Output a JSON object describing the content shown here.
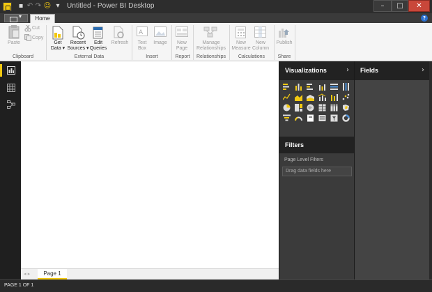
{
  "window": {
    "title": "Untitled - Power BI Desktop",
    "minimize": "–",
    "maximize": "□",
    "close": "✕"
  },
  "tabs": {
    "home": "Home",
    "help": "?"
  },
  "ribbon": {
    "clipboard": {
      "paste": "Paste",
      "cut": "Cut",
      "copy": "Copy",
      "group": "Clipboard"
    },
    "external": {
      "get_data": "Get\nData ▾",
      "recent": "Recent\nSources ▾",
      "edit": "Edit\nQueries",
      "refresh": "Refresh",
      "group": "External Data"
    },
    "insert": {
      "textbox": "Text\nBox",
      "image": "Image",
      "group": "Insert"
    },
    "report": {
      "newpage": "New\nPage",
      "group": "Report"
    },
    "relationships": {
      "manage": "Manage\nRelationships",
      "group": "Relationships"
    },
    "calculations": {
      "measure": "New\nMeasure",
      "column": "New\nColumn",
      "group": "Calculations"
    },
    "share": {
      "publish": "Publish",
      "group": "Share"
    }
  },
  "panes": {
    "visualizations": "Visualizations",
    "fields": "Fields",
    "filters": "Filters",
    "page_level_filters": "Page Level Filters",
    "drag_here": "Drag data fields here",
    "chevron": "›"
  },
  "page": {
    "tab": "Page 1"
  },
  "status": {
    "text": "PAGE 1 OF 1"
  },
  "colors": {
    "accent": "#f2c811",
    "dark_pane": "#222222"
  }
}
